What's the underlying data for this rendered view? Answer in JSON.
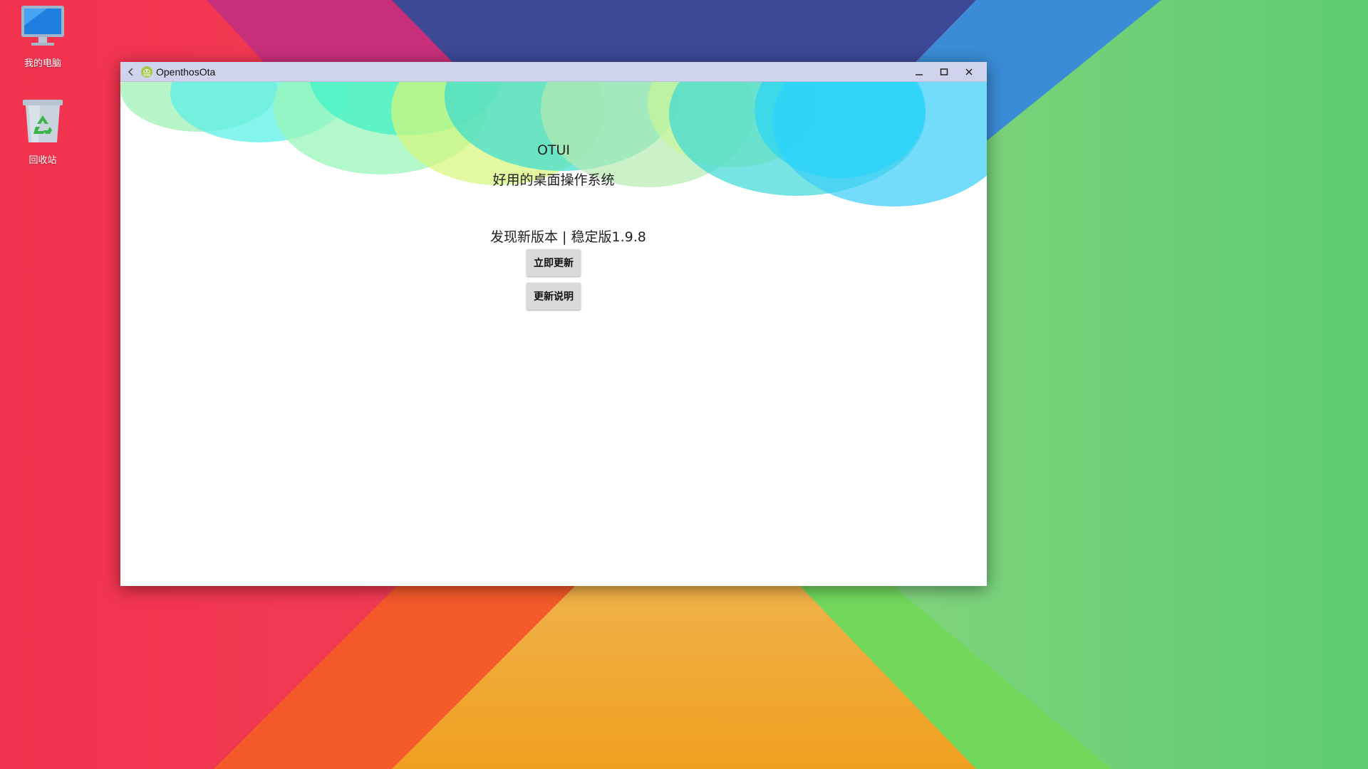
{
  "desktop": {
    "icons": [
      {
        "label": "我的电脑",
        "icon": "computer-icon"
      },
      {
        "label": "回收站",
        "icon": "recycle-bin-icon"
      }
    ],
    "wallpaper_colors": [
      "#f23a56",
      "#c4317a",
      "#3e4b99",
      "#4a8fd8",
      "#5ccb74",
      "#f06a30",
      "#f2a531",
      "#73d96a"
    ]
  },
  "window": {
    "title": "OpenthosOta",
    "app_icon": "android-icon",
    "controls": {
      "back": "back-arrow-icon",
      "minimize": "minimize-icon",
      "maximize": "maximize-icon",
      "close": "close-icon"
    },
    "titlebar_color": "#cfd3ec"
  },
  "app": {
    "name": "OTUI",
    "slogan": "好用的桌面操作系统",
    "update_info": "发现新版本 | 稳定版1.9.8",
    "update_button": "立即更新",
    "notes_button": "更新说明"
  }
}
